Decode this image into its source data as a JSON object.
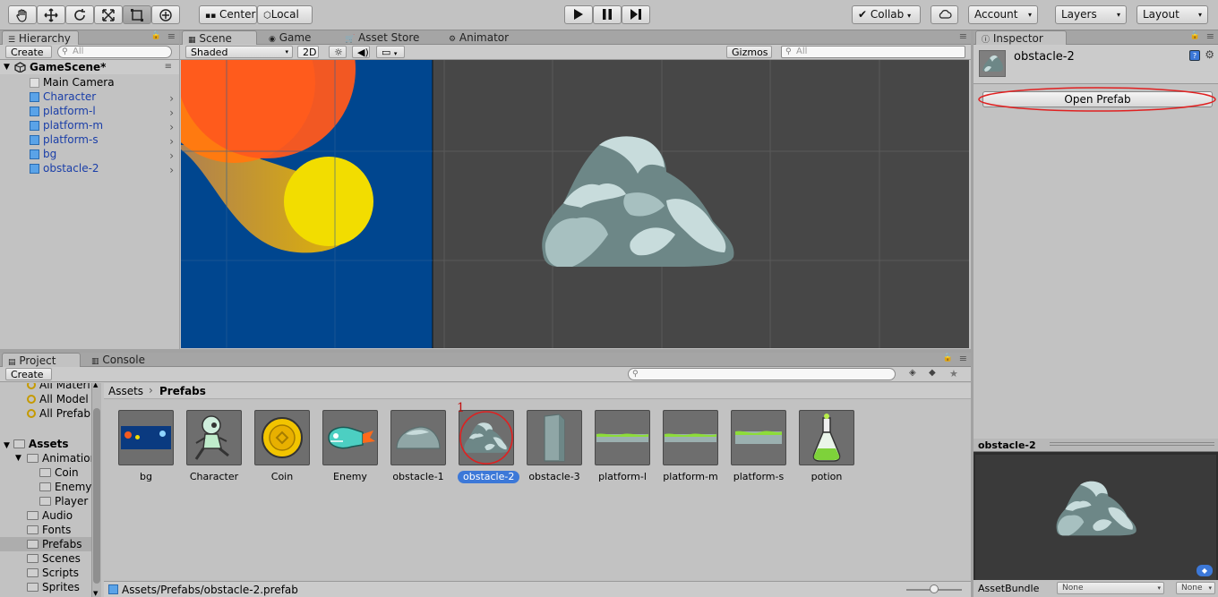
{
  "toolbar": {
    "center_label": "Center",
    "local_label": "Local",
    "collab_label": "Collab",
    "account_label": "Account",
    "layers_label": "Layers",
    "layout_label": "Layout"
  },
  "hierarchy": {
    "tab_label": "Hierarchy",
    "create_label": "Create",
    "search_placeholder": "All",
    "scene_name": "GameScene*",
    "items": [
      {
        "label": "Main Camera",
        "prefab": false
      },
      {
        "label": "Character",
        "prefab": true
      },
      {
        "label": "platform-l",
        "prefab": true
      },
      {
        "label": "platform-m",
        "prefab": true
      },
      {
        "label": "platform-s",
        "prefab": true
      },
      {
        "label": "bg",
        "prefab": true
      },
      {
        "label": "obstacle-2",
        "prefab": true
      }
    ]
  },
  "scene_view": {
    "tabs": [
      "Scene",
      "Game",
      "Asset Store",
      "Animator"
    ],
    "shading_mode": "Shaded",
    "mode_2d_label": "2D",
    "gizmos_label": "Gizmos",
    "search_placeholder": "All"
  },
  "inspector": {
    "tab_label": "Inspector",
    "object_name": "obstacle-2",
    "open_prefab_label": "Open Prefab",
    "preview_title": "obstacle-2",
    "assetbundle_label": "AssetBundle",
    "assetbundle_value": "None",
    "assetbundle_variant": "None"
  },
  "project": {
    "tabs": [
      "Project",
      "Console"
    ],
    "create_label": "Create",
    "favorites": [
      "All Materi",
      "All Model",
      "All Prefab"
    ],
    "assets_root": "Assets",
    "tree": [
      {
        "label": "Animation",
        "level": 1
      },
      {
        "label": "Coin",
        "level": 2
      },
      {
        "label": "Enemy",
        "level": 2
      },
      {
        "label": "Player",
        "level": 2
      },
      {
        "label": "Audio",
        "level": 1
      },
      {
        "label": "Fonts",
        "level": 1
      },
      {
        "label": "Prefabs",
        "level": 1,
        "selected": true
      },
      {
        "label": "Scenes",
        "level": 1
      },
      {
        "label": "Scripts",
        "level": 1
      },
      {
        "label": "Sprites",
        "level": 1
      }
    ],
    "breadcrumb": [
      "Assets",
      "Prefabs"
    ],
    "assets": [
      "bg",
      "Character",
      "Coin",
      "Enemy",
      "obstacle-1",
      "obstacle-2",
      "obstacle-3",
      "platform-l",
      "platform-m",
      "platform-s",
      "potion"
    ],
    "selected_asset": "obstacle-2",
    "annotation_number": "1",
    "status_path": "Assets/Prefabs/obstacle-2.prefab"
  },
  "colors": {
    "accent": "#3c78d8",
    "highlight": "#e02020",
    "scene_bg": "#474747",
    "game_bg": "#00468f"
  }
}
